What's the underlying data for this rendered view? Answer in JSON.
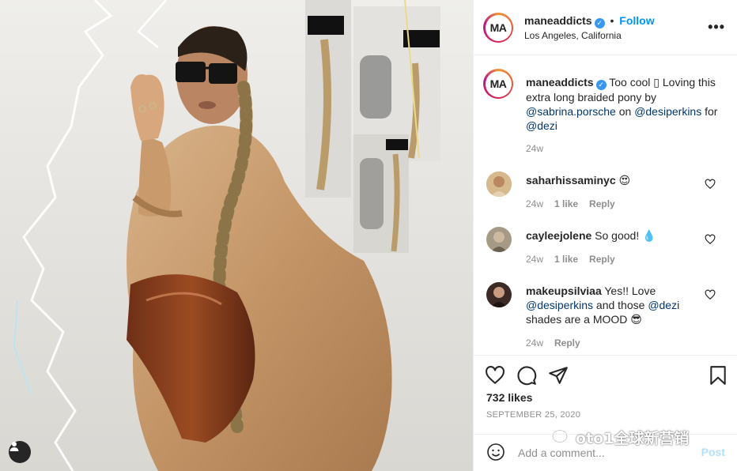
{
  "post": {
    "image_alt": "Collage: woman in sunglasses and tan patent trench coat with long braided ponytail",
    "user_tag_icon": "person-icon"
  },
  "header": {
    "avatar_initials": "MA",
    "username": "maneaddicts",
    "verified": true,
    "separator": "•",
    "follow_label": "Follow",
    "location": "Los Angeles, California",
    "more_icon": "more-horizontal-icon"
  },
  "caption": {
    "avatar_initials": "MA",
    "username": "maneaddicts",
    "text_1": "Too cool",
    "text_glyph": "▯",
    "text_2": "Loving this extra long braided pony by",
    "mention_1": "@sabrina.porsche",
    "text_3": "on",
    "mention_2": "@desiperkins",
    "text_4": "for",
    "mention_3": "@dezi",
    "time": "24w"
  },
  "comments": [
    {
      "username": "saharhissaminyc",
      "text": "😍",
      "time": "24w",
      "likes": "1 like",
      "reply": "Reply",
      "avatar_color": "#c9a677"
    },
    {
      "username": "cayleejolene",
      "text": "So good! 💧",
      "time": "24w",
      "likes": "1 like",
      "reply": "Reply",
      "avatar_color": "#8a7f6a"
    },
    {
      "username": "makeupsilviaa",
      "text_1": "Yes!! Love",
      "mention_1": "@desiperkins",
      "text_2": "and those",
      "mention_2": "@dezi",
      "text_3": "shades are a MOOD 😎",
      "time": "24w",
      "reply": "Reply",
      "avatar_color": "#3b2a26"
    }
  ],
  "actions": {
    "icons": [
      "heart-icon",
      "comment-icon",
      "share-icon",
      "bookmark-icon"
    ],
    "likes": "732 likes",
    "date": "SEPTEMBER 25, 2020"
  },
  "add_comment": {
    "placeholder": "Add a comment...",
    "post_label": "Post",
    "emoji_icon": "smiley-icon"
  },
  "watermark": {
    "text": "oto1全球新营销",
    "icon": "wechat-icon"
  },
  "colors": {
    "link": "#00376b",
    "follow": "#0095f6",
    "muted": "#8e8e8e",
    "post_disabled": "#b2dffc"
  }
}
